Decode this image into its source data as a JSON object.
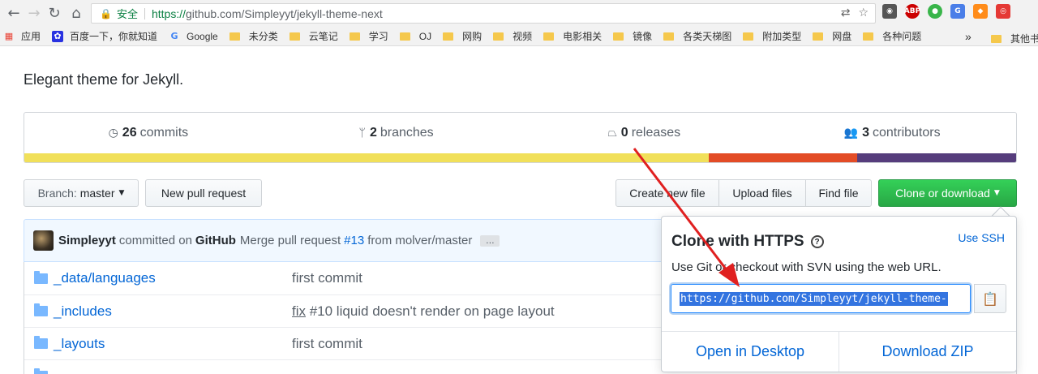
{
  "browser": {
    "security_label": "安全",
    "url_scheme": "https://",
    "url_rest": "github.com/Simpleyyt/jekyll-theme-next"
  },
  "bookmarks": {
    "apps": "应用",
    "baidu": "百度一下，你就知道",
    "google": "Google",
    "folders": [
      "未分类",
      "云笔记",
      "学习",
      "OJ",
      "网购",
      "视频",
      "电影相关",
      "镜像",
      "各类天梯图",
      "附加类型",
      "网盘",
      "各种问题"
    ],
    "overflow": "»",
    "other": "其他书"
  },
  "repo": {
    "description": "Elegant theme for Jekyll."
  },
  "summary": {
    "commits_count": "26",
    "commits_label": "commits",
    "branches_count": "2",
    "branches_label": "branches",
    "releases_count": "0",
    "releases_label": "releases",
    "contributors_count": "3",
    "contributors_label": "contributors",
    "languages": [
      {
        "color": "#f1e05a",
        "fraction": 0.69
      },
      {
        "color": "#e34c26",
        "fraction": 0.15
      },
      {
        "color": "#563d7c",
        "fraction": 0.16
      }
    ]
  },
  "toolbar": {
    "branch_prefix": "Branch:",
    "branch_name": "master",
    "new_pull_request": "New pull request",
    "create_new_file": "Create new file",
    "upload_files": "Upload files",
    "find_file": "Find file",
    "clone_or_download": "Clone or download"
  },
  "commit": {
    "author": "Simpleyyt",
    "committed_on": "committed on",
    "platform": "GitHub",
    "message_pre": "Merge pull request",
    "pr_link": "#13",
    "message_post": "from molver/master",
    "ellipsis": "…"
  },
  "files": [
    {
      "name_prefix": "_data/",
      "name": "languages",
      "message": "first commit"
    },
    {
      "name_prefix": "",
      "name": "_includes",
      "message_link": "fix",
      "message": " #10 liquid doesn't render on page layout"
    },
    {
      "name_prefix": "",
      "name": "_layouts",
      "message": "first commit"
    }
  ],
  "clone_popover": {
    "title": "Clone with HTTPS",
    "help": "?",
    "use_ssh": "Use SSH",
    "description": "Use Git or checkout with SVN using the web URL.",
    "url": "https://github.com/Simpleyyt/jekyll-theme-",
    "open_desktop": "Open in Desktop",
    "download_zip": "Download ZIP"
  }
}
